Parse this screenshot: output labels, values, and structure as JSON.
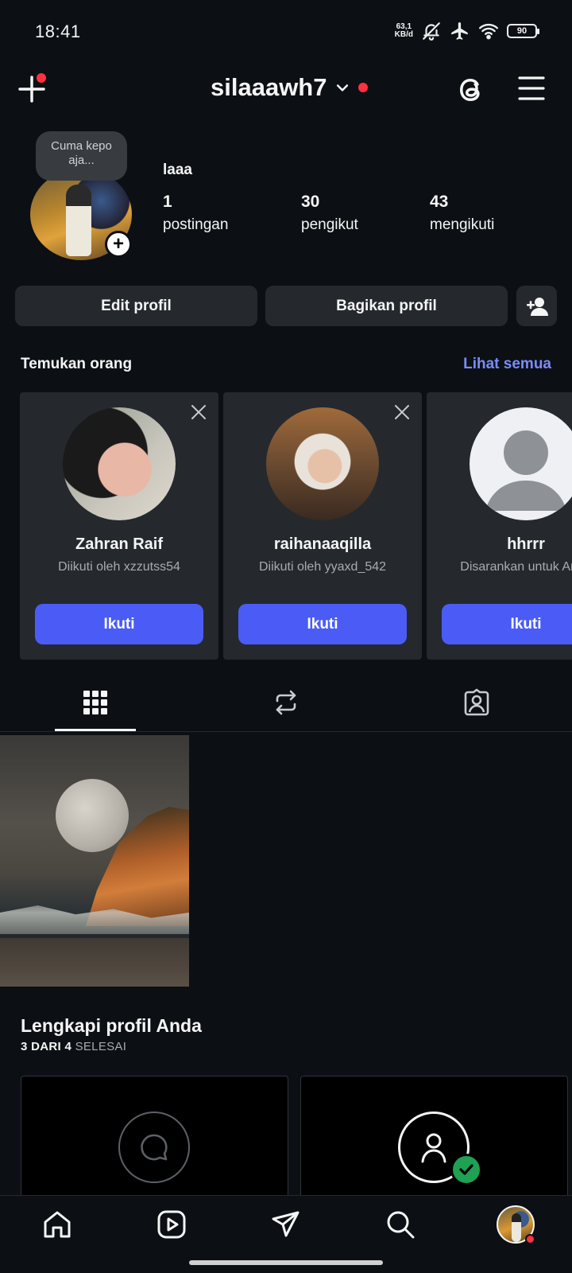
{
  "status_bar": {
    "time": "18:41",
    "net_speed_value": "63,1",
    "net_speed_unit": "KB/d",
    "battery": "90",
    "icons": [
      "bell-off-icon",
      "airplane-icon",
      "wifi-icon",
      "battery-icon"
    ]
  },
  "header": {
    "username": "silaaawh7",
    "icons": [
      "plus-icon",
      "chevron-down-icon",
      "threads-icon",
      "menu-icon"
    ],
    "accent_dot_color": "#ff3040"
  },
  "profile": {
    "note": "Cuma kepo aja...",
    "display_name": "laaa",
    "stats": [
      {
        "value": "1",
        "label": "postingan"
      },
      {
        "value": "30",
        "label": "pengikut"
      },
      {
        "value": "43",
        "label": "mengikuti"
      }
    ]
  },
  "actions": {
    "edit_label": "Edit profil",
    "share_label": "Bagikan profil"
  },
  "discover": {
    "title": "Temukan orang",
    "see_all": "Lihat semua",
    "link_color": "#7b8cff",
    "people": [
      {
        "name": "Zahran Raif",
        "subtitle": "Diikuti oleh xzzutss54",
        "button": "Ikuti"
      },
      {
        "name": "raihanaaqilla",
        "subtitle": "Diikuti oleh yyaxd_542",
        "button": "Ikuti"
      },
      {
        "name": "hhrrr",
        "subtitle": "Disarankan untuk Anda",
        "button": "Ikuti"
      }
    ],
    "button_color": "#4a5cf5"
  },
  "tabs": {
    "items": [
      "grid-icon",
      "reposts-icon",
      "tagged-icon"
    ],
    "active": "grid-icon"
  },
  "complete_profile": {
    "title": "Lengkapi profil Anda",
    "progress_count": "3 DARI 4",
    "progress_word": "SELESAI"
  },
  "bottom_nav": {
    "items": [
      "home-icon",
      "reels-icon",
      "direct-icon",
      "search-icon",
      "profile-avatar"
    ]
  }
}
